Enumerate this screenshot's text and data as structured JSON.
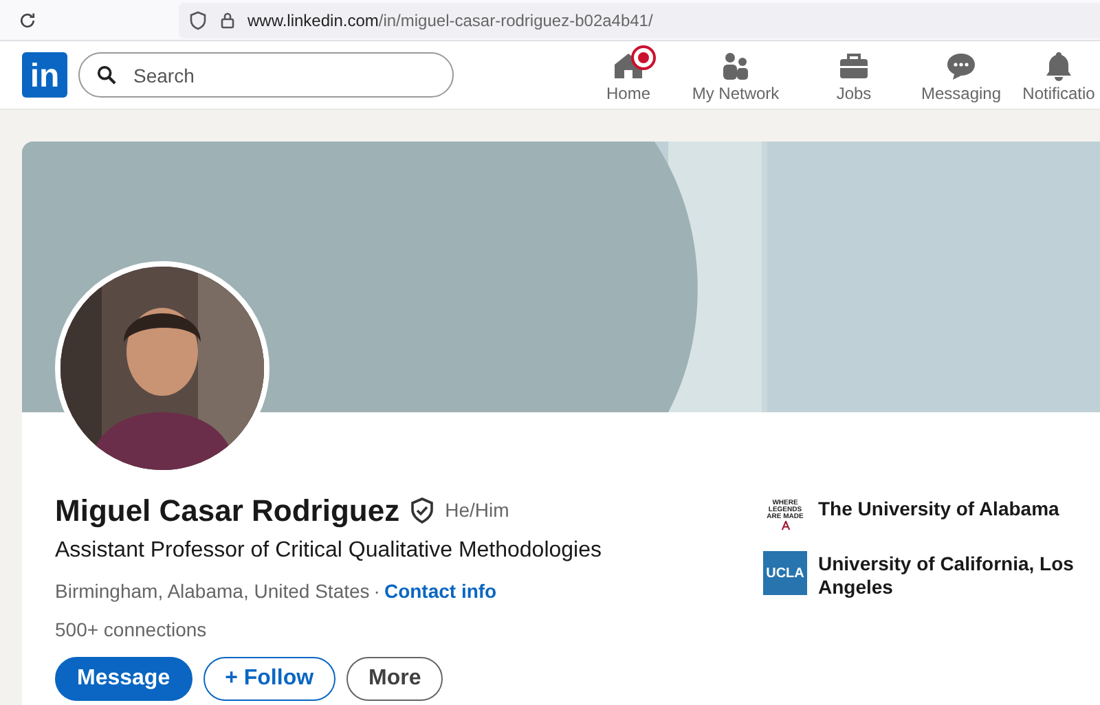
{
  "browser": {
    "url_host": "www.linkedin.com",
    "url_path": "/in/miguel-casar-rodriguez-b02a4b41/"
  },
  "nav": {
    "logo": "in",
    "search": {
      "placeholder": "Search"
    },
    "items": [
      {
        "label": "Home",
        "kind": "home",
        "badge": true
      },
      {
        "label": "My Network",
        "kind": "network",
        "badge": false
      },
      {
        "label": "Jobs",
        "kind": "jobs",
        "badge": false
      },
      {
        "label": "Messaging",
        "kind": "messaging",
        "badge": false
      },
      {
        "label": "Notificatio",
        "kind": "notifications",
        "badge": false
      }
    ]
  },
  "profile": {
    "name": "Miguel Casar Rodriguez",
    "verified": true,
    "pronouns": "He/Him",
    "headline": "Assistant Professor of Critical Qualitative Methodologies",
    "location": "Birmingham, Alabama, United States",
    "separator": "·",
    "contact_link": "Contact info",
    "connections": "500+ connections",
    "actions": [
      {
        "label": "Message",
        "kind": "primary"
      },
      {
        "label": "+ Follow",
        "kind": "secondary"
      },
      {
        "label": "More",
        "kind": "tertiary"
      }
    ],
    "education": [
      {
        "name": "The University of Alabama",
        "kind": "alabama",
        "logo_text": [
          "WHERE",
          "LEGENDS",
          "ARE MADE"
        ]
      },
      {
        "name": "University of California, Los Angeles",
        "kind": "ucla",
        "logo_text": [
          "UCLA"
        ]
      }
    ]
  }
}
